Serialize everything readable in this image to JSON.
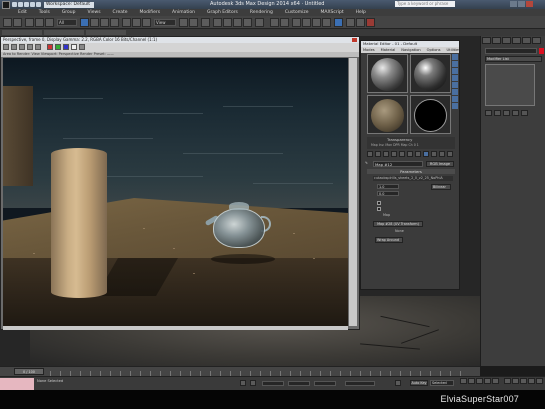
{
  "titlebar": {
    "workspace": "Workspace: Default",
    "title": "Autodesk 3ds Max Design 2014 x64 · Untitled",
    "search_placeholder": "Type a keyword or phrase"
  },
  "menu": [
    "Edit",
    "Tools",
    "Group",
    "Views",
    "Create",
    "Modifiers",
    "Animation",
    "Graph Editors",
    "Rendering",
    "Customize",
    "MAXScript",
    "Help"
  ],
  "toolbar": {
    "dropdown_all": "All",
    "dropdown_view": "View"
  },
  "frame_buffer": {
    "title": "Perspective, frame 0, Display Gamma: 2.2, RGBA Color 16 Bits/Channel (1:1)",
    "info": "Area to Render: View   Viewport: Perspective   Render Preset:  ——"
  },
  "material_editor": {
    "title": "Material Editor - 01 - Default",
    "menu": [
      "Modes",
      "Material",
      "Navigation",
      "Options",
      "Utilities"
    ],
    "transparency_label": "Transparency",
    "transparency_sub": "Map   Inv. Mon   DPR   Map Ch   0 1",
    "material_name": "Map #12",
    "material_type": "RGB Image",
    "rollout_title": "Parameters",
    "bitmap_path": "cutaobsplrills_sheets_2_0_v2_25_NoPhiA",
    "field1": "1.0",
    "field2": "0.0",
    "dropdown_value": "Bilinear",
    "map_label": "Map",
    "xform_button": "Map #28 (UV Transform)",
    "none_label": "None",
    "wrap_dropdown": "Wrap Around"
  },
  "command_panel": {
    "modifier_list": "Modifier List"
  },
  "timeline": {
    "slider": "0 / 100"
  },
  "statusbar": {
    "status_text": "None Selected",
    "autokey": "Auto Key",
    "selected_dropdown": "Selected"
  },
  "watermark": "ElviaSuperStar007"
}
